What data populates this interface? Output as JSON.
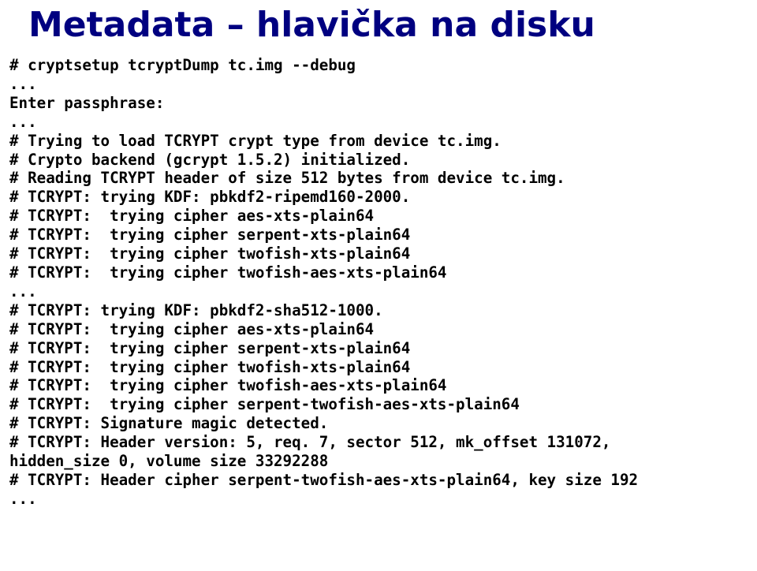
{
  "title": "Metadata – hlavička na disku",
  "lines": {
    "l0": "# cryptsetup tcryptDump tc.img --debug",
    "l1": "...",
    "l2": "Enter passphrase:",
    "l3": "...",
    "l4": "# Trying to load TCRYPT crypt type from device tc.img.",
    "l5": "# Crypto backend (gcrypt 1.5.2) initialized.",
    "l6": "# Reading TCRYPT header of size 512 bytes from device tc.img.",
    "l7": "# TCRYPT: trying KDF: pbkdf2-ripemd160-2000.",
    "l8": "# TCRYPT:  trying cipher aes-xts-plain64",
    "l9": "# TCRYPT:  trying cipher serpent-xts-plain64",
    "l10": "# TCRYPT:  trying cipher twofish-xts-plain64",
    "l11": "# TCRYPT:  trying cipher twofish-aes-xts-plain64",
    "l12": "...",
    "l13": "# TCRYPT: trying KDF: pbkdf2-sha512-1000.",
    "l14": "# TCRYPT:  trying cipher aes-xts-plain64",
    "l15": "# TCRYPT:  trying cipher serpent-xts-plain64",
    "l16": "# TCRYPT:  trying cipher twofish-xts-plain64",
    "l17": "# TCRYPT:  trying cipher twofish-aes-xts-plain64",
    "l18": "# TCRYPT:  trying cipher serpent-twofish-aes-xts-plain64",
    "l19": "# TCRYPT: Signature magic detected.",
    "l20": "# TCRYPT: Header version: 5, req. 7, sector 512, mk_offset 131072,",
    "l21": "hidden_size 0, volume size 33292288",
    "l22": "# TCRYPT: Header cipher serpent-twofish-aes-xts-plain64, key size 192",
    "l23": "..."
  }
}
